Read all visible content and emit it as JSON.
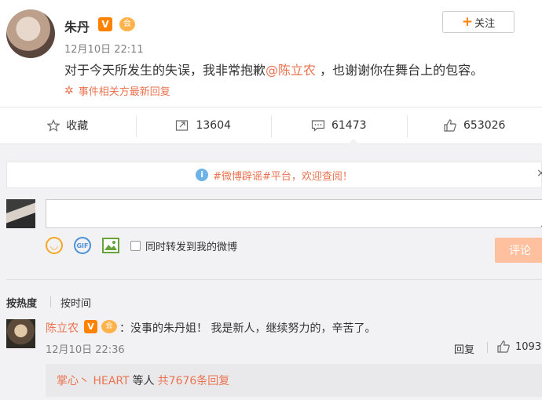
{
  "post": {
    "author": "朱丹",
    "verified_badge": "V",
    "member_badge": "会",
    "follow_label": "关注",
    "follow_plus": "+",
    "time": "12月10日 22:11",
    "text_before": "对于今天所发生的失误，我非常抱歉",
    "mention": "@陈立农",
    "text_after": " ，也谢谢你在舞台上的包容。",
    "event_link": "事件相关方最新回复"
  },
  "actions": {
    "favorite": "收藏",
    "repost_count": "13604",
    "comment_count": "61473",
    "like_count": "653026"
  },
  "notice": {
    "text": "#微博辟谣#平台，欢迎查阅！",
    "close": "×"
  },
  "composer": {
    "input_value": "",
    "forward_label": "同时转发到我的微博",
    "submit_label": "评论"
  },
  "sort": {
    "hot": "按热度",
    "time": "按时间"
  },
  "comment": {
    "author": "陈立农",
    "verified_badge": "V",
    "member_badge": "会",
    "text": "：没事的朱丹姐！ 我是新人，继续努力的，辛苦了。",
    "time": "12月10日 22:36",
    "reply_label": "回复",
    "like_count": "1093",
    "sub_who": "掌心丶 HEART",
    "sub_mid": "等人",
    "sub_more": "共7676条回复"
  },
  "colors": {
    "accent": "#eb7350",
    "brand_orange": "#ff8200",
    "submit_disabled": "#ffc09f"
  }
}
